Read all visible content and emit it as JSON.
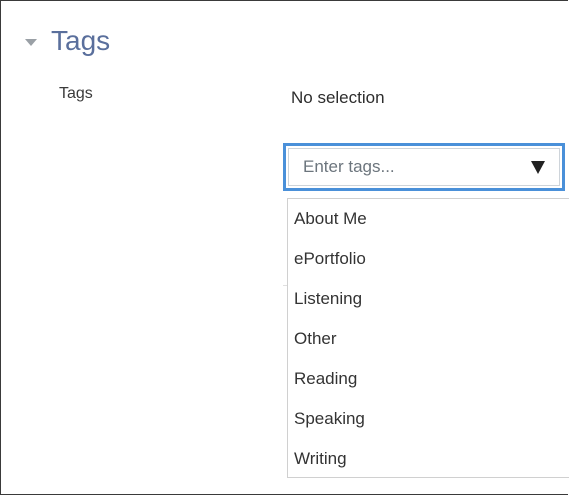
{
  "section": {
    "title": "Tags"
  },
  "field": {
    "label": "Tags",
    "selection_text": "No selection",
    "input_placeholder": "Enter tags...",
    "options": [
      "About Me",
      "ePortfolio",
      "Listening",
      "Other",
      "Reading",
      "Speaking",
      "Writing"
    ]
  },
  "colors": {
    "title": "#5a6f9c",
    "focus_border": "#4a90d9"
  },
  "icons": {
    "collapse": "collapse-triangle-icon",
    "dropdown": "dropdown-arrow-icon"
  }
}
